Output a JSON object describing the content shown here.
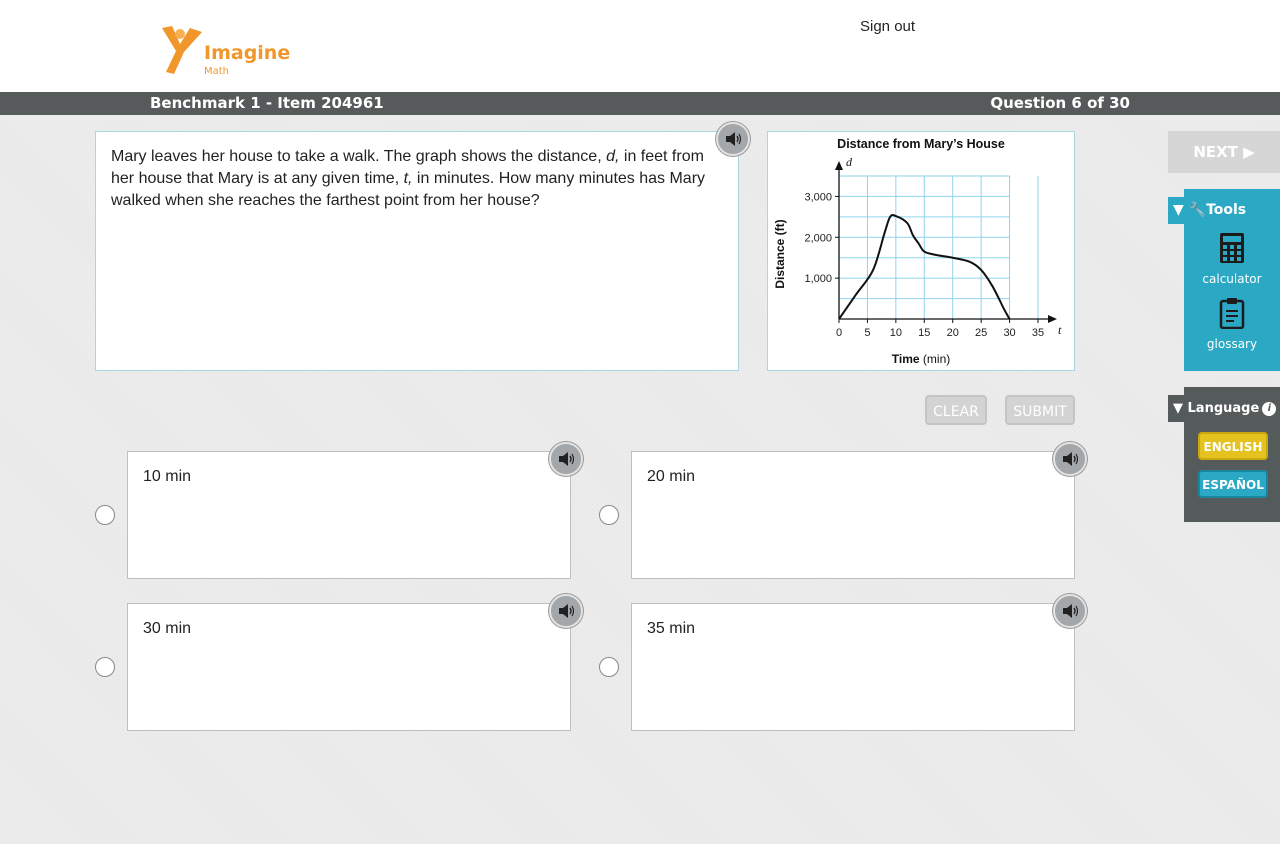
{
  "header": {
    "logo_name": "Imagine",
    "logo_sub": "Math",
    "sign_out": "Sign out"
  },
  "titlebar": {
    "benchmark": "Benchmark 1 - Item 204961",
    "question_counter": "Question 6 of 30"
  },
  "question": {
    "text_parts": [
      "Mary leaves her house to take a walk. The graph shows the distance, ",
      "d,",
      " in feet from her house that Mary is at any given time, ",
      "t,",
      " in minutes. How many minutes has Mary walked when she reaches the farthest point from her house?"
    ]
  },
  "graph": {
    "title": "Distance from Mary’s House",
    "y_var": "d",
    "x_var": "t",
    "ylabel": "Distance (ft)",
    "xlabel_bold": "Time",
    "xlabel_unit": "(min)",
    "x_ticks": [
      "0",
      "5",
      "10",
      "15",
      "20",
      "25",
      "30",
      "35"
    ],
    "y_ticks": [
      "1,000",
      "2,000",
      "3,000"
    ]
  },
  "chart_data": {
    "type": "line",
    "title": "Distance from Mary’s House",
    "xlabel": "Time (min)",
    "ylabel": "Distance (ft)",
    "xlim": [
      0,
      35
    ],
    "ylim": [
      0,
      3500
    ],
    "grid": true,
    "series": [
      {
        "x": [
          0,
          3,
          6,
          8,
          9,
          10,
          12,
          13,
          14,
          15,
          17,
          20,
          23,
          25,
          27,
          29,
          30
        ],
        "values": [
          0,
          600,
          1200,
          2100,
          2500,
          2520,
          2350,
          2050,
          1850,
          1650,
          1570,
          1500,
          1400,
          1200,
          800,
          250,
          0
        ]
      }
    ]
  },
  "answers": [
    {
      "label": "10 min"
    },
    {
      "label": "20 min"
    },
    {
      "label": "30 min"
    },
    {
      "label": "35 min"
    }
  ],
  "buttons": {
    "clear": "CLEAR",
    "submit": "SUBMIT",
    "next": "NEXT ▶"
  },
  "tools": {
    "title": "▼ 🔧Tools",
    "items": [
      {
        "label": "calculator",
        "icon": "calculator-icon"
      },
      {
        "label": "glossary",
        "icon": "glossary-icon"
      }
    ]
  },
  "language": {
    "title": "▼ Language",
    "info": "i",
    "english": "ENGLISH",
    "spanish": "ESPAÑOL"
  },
  "colors": {
    "accent_teal": "#2aa8c4",
    "title_bar": "#565a5a",
    "logo_orange": "#f0962a",
    "english_yellow": "#e4c21f"
  }
}
